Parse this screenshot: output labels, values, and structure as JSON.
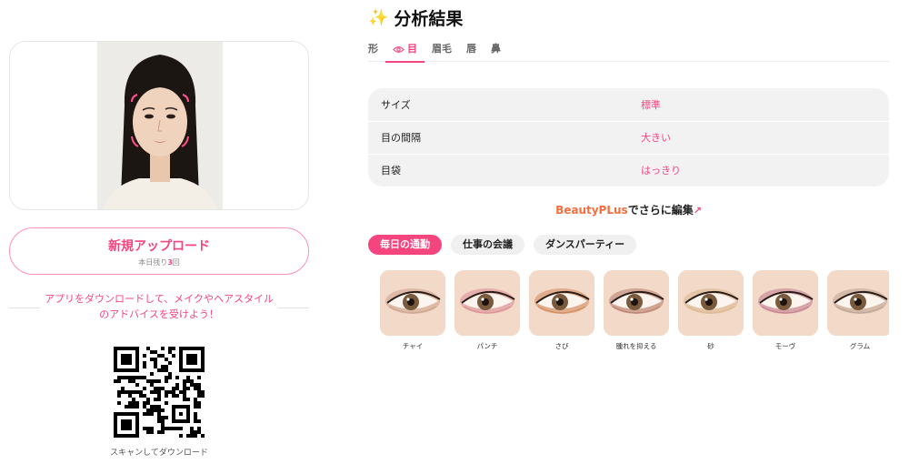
{
  "left": {
    "upload": {
      "label": "新規アップロード",
      "sub_prefix": "本日残り",
      "remaining": "3",
      "sub_suffix": "回"
    },
    "promo": {
      "text": "アプリをダウンロードして、メイクやヘアスタイルのアドバイスを受けよう！"
    },
    "qr": {
      "caption": "スキャンしてダウンロード"
    }
  },
  "header": {
    "icon": "sparkles-icon",
    "title": "分析結果"
  },
  "tabs": [
    {
      "label": "形",
      "active": false
    },
    {
      "label": "目",
      "active": true,
      "icon": "eye-icon"
    },
    {
      "label": "眉毛",
      "active": false
    },
    {
      "label": "唇",
      "active": false
    },
    {
      "label": "鼻",
      "active": false
    }
  ],
  "results": [
    {
      "key": "サイズ",
      "value": "標準"
    },
    {
      "key": "目の間隔",
      "value": "大きい"
    },
    {
      "key": "目袋",
      "value": "はっきり"
    }
  ],
  "edit_link": {
    "brand": "BeautyPLus",
    "text": "でさらに編集",
    "icon": "arrow-up-right-icon"
  },
  "chips": [
    {
      "label": "毎日の通勤",
      "active": true
    },
    {
      "label": "仕事の会議",
      "active": false
    },
    {
      "label": "ダンスパーティー",
      "active": false
    }
  ],
  "looks": [
    {
      "name": "チャイ",
      "shadow": "#c9a08a"
    },
    {
      "name": "パンチ",
      "shadow": "#d98a95"
    },
    {
      "name": "さび",
      "shadow": "#d0865a"
    },
    {
      "name": "腫れを抑える",
      "shadow": "#b57a6a"
    },
    {
      "name": "砂",
      "shadow": "#d8b58e"
    },
    {
      "name": "モーヴ",
      "shadow": "#c07a8e"
    },
    {
      "name": "グラム",
      "shadow": "#b9a08f"
    }
  ],
  "colors": {
    "accent": "#f5457f",
    "brand": "#f56e3d",
    "card_bg": "#f2f2f2"
  }
}
